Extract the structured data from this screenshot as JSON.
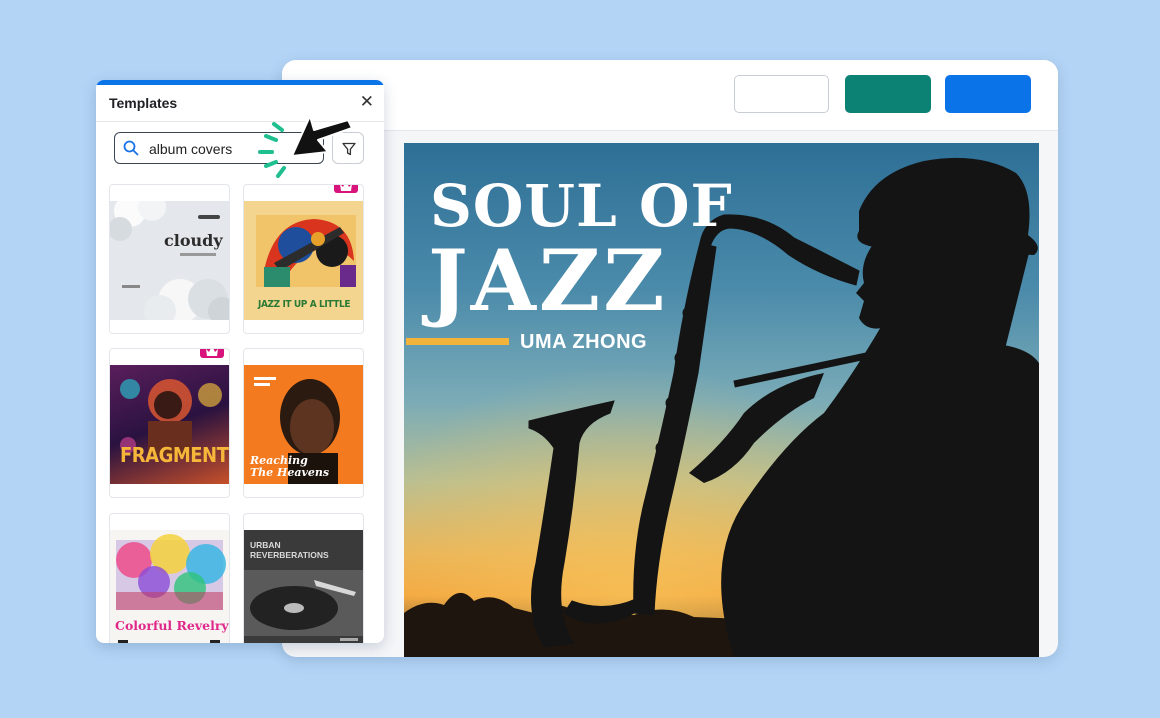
{
  "editor": {
    "toolbar": {
      "buttons": [
        {
          "label": "",
          "color": "#ffffff"
        },
        {
          "label": "",
          "color": "#0b8274"
        },
        {
          "label": "",
          "color": "#0a73e8"
        }
      ]
    },
    "canvas": {
      "title_line1": "SOUL OF",
      "title_line2": "JAZZ",
      "author": "UMA ZHONG",
      "accent_color": "#f2b33a"
    }
  },
  "templates_panel": {
    "title": "Templates",
    "close_icon": "close-icon",
    "search": {
      "value": "album covers",
      "icon": "search-icon"
    },
    "filter_icon": "filter-icon",
    "accent_color": "#0a73e8",
    "premium_color": "#d8137c",
    "cards": [
      {
        "title": "cloudy",
        "premium": false
      },
      {
        "title": "JAZZ IT UP A LITTLE",
        "premium": true
      },
      {
        "title": "FRAGMENTS",
        "premium": true
      },
      {
        "title": "Reaching The Heavens",
        "premium": false
      },
      {
        "title": "Colorful Revelry",
        "premium": false
      },
      {
        "title": "URBAN REVERBERATIONS",
        "premium": false
      }
    ]
  }
}
